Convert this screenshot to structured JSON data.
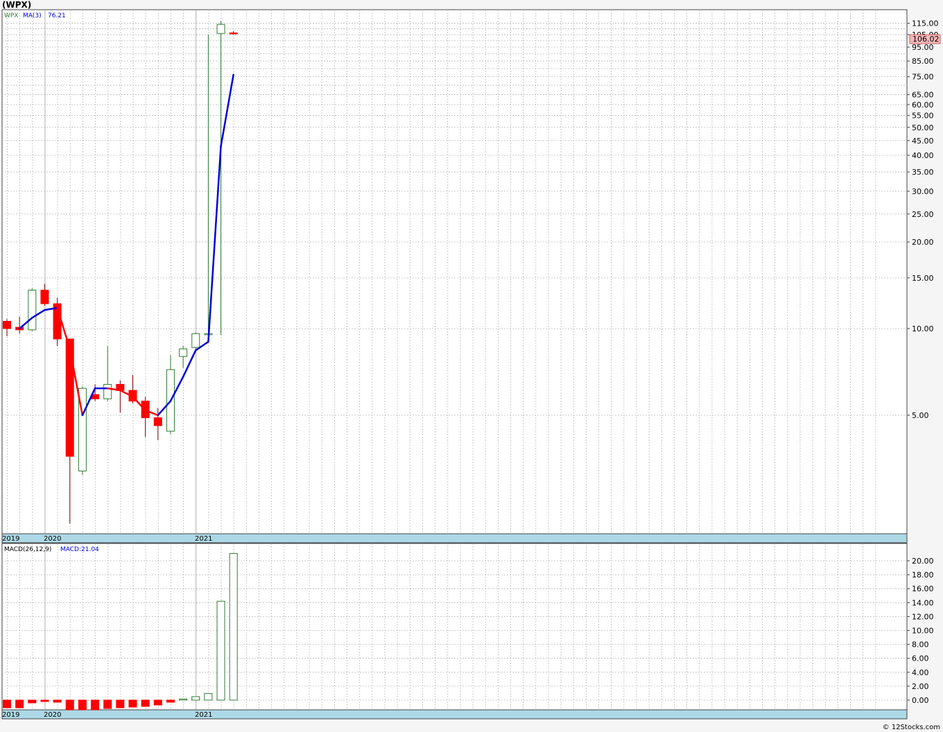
{
  "title": "(WPX)",
  "watermark": "© 12Stocks.com",
  "colors": {
    "up": "#2e7d32",
    "down": "#ff0000",
    "ma": "#0000dd",
    "ma_down": "#ff0000",
    "axis_band": "#add8e6",
    "grid": "#bbbbbb",
    "price_tag_bg": "#f4b8b8"
  },
  "price_panel": {
    "legend": {
      "symbol": "WPX",
      "ma_label": "MA(3)",
      "ma_value": "76.21"
    },
    "last_price": "106.02",
    "tick_labels": [
      "5.00",
      "10.00",
      "15.00",
      "20.00",
      "25.00",
      "30.00",
      "35.00",
      "40.00",
      "45.00",
      "50.00",
      "55.00",
      "60.00",
      "65.00",
      "75.00",
      "85.00",
      "95.00",
      "105.00",
      "115.00"
    ],
    "year_labels": [
      "2019",
      "2020",
      "2021"
    ]
  },
  "macd_panel": {
    "legend": {
      "label": "MACD(26,12,9)",
      "value_label": "MACD:21.04"
    },
    "tick_labels": [
      "0.00",
      "2.00",
      "4.00",
      "6.00",
      "8.00",
      "10.00",
      "12.00",
      "14.00",
      "16.00",
      "18.00",
      "20.00"
    ],
    "year_labels": [
      "2019",
      "2020",
      "2021"
    ]
  },
  "chart_data": [
    {
      "type": "candlestick",
      "title": "(WPX)",
      "scale": "log",
      "ylim": [
        3.0,
        120
      ],
      "grid": true,
      "series": [
        {
          "name": "WPX",
          "candles": [
            {
              "o": 10.6,
              "h": 10.8,
              "l": 9.4,
              "c": 10.0
            },
            {
              "o": 10.1,
              "h": 11.0,
              "l": 9.6,
              "c": 9.9
            },
            {
              "o": 9.9,
              "h": 13.8,
              "l": 9.8,
              "c": 13.6
            },
            {
              "o": 13.6,
              "h": 14.3,
              "l": 12.0,
              "c": 12.2
            },
            {
              "o": 12.2,
              "h": 12.8,
              "l": 8.7,
              "c": 9.2
            },
            {
              "o": 9.2,
              "h": 9.2,
              "l": 2.1,
              "c": 3.6
            },
            {
              "o": 3.2,
              "h": 6.3,
              "l": 3.1,
              "c": 6.2
            },
            {
              "o": 5.9,
              "h": 6.4,
              "l": 5.6,
              "c": 5.7
            },
            {
              "o": 5.7,
              "h": 8.7,
              "l": 5.6,
              "c": 6.4
            },
            {
              "o": 6.4,
              "h": 6.6,
              "l": 5.1,
              "c": 6.1
            },
            {
              "o": 6.1,
              "h": 6.9,
              "l": 5.5,
              "c": 5.6
            },
            {
              "o": 5.6,
              "h": 5.8,
              "l": 4.2,
              "c": 4.9
            },
            {
              "o": 4.9,
              "h": 5.3,
              "l": 4.1,
              "c": 4.6
            },
            {
              "o": 4.4,
              "h": 8.1,
              "l": 4.3,
              "c": 7.2
            },
            {
              "o": 8.0,
              "h": 8.7,
              "l": 7.3,
              "c": 8.5
            },
            {
              "o": 8.6,
              "h": 9.7,
              "l": 8.4,
              "c": 9.6
            },
            {
              "o": 9.6,
              "h": 105,
              "l": 9.6,
              "c": 9.6
            },
            {
              "o": 106,
              "h": 117,
              "l": 9.5,
              "c": 114
            },
            {
              "o": 106.5,
              "h": 108,
              "l": 105,
              "c": 106.02
            }
          ]
        },
        {
          "name": "MA(3)",
          "values": [
            null,
            10.0,
            10.9,
            11.6,
            11.8,
            8.5,
            5.0,
            6.2,
            6.2,
            6.1,
            5.8,
            5.2,
            5.0,
            5.6,
            6.8,
            8.4,
            9.0,
            43.0,
            76.21
          ]
        }
      ]
    },
    {
      "type": "bar",
      "title": "MACD(26,12,9)",
      "ylim": [
        -1.2,
        21.2
      ],
      "grid": true,
      "series": [
        {
          "name": "MACD",
          "values": [
            -1.1,
            -1.1,
            -0.4,
            -0.2,
            -0.3,
            -1.4,
            -1.4,
            -1.4,
            -1.2,
            -1.1,
            -1.0,
            -0.9,
            -0.7,
            -0.3,
            0.15,
            0.5,
            0.95,
            14.2,
            21.04
          ]
        }
      ]
    }
  ]
}
